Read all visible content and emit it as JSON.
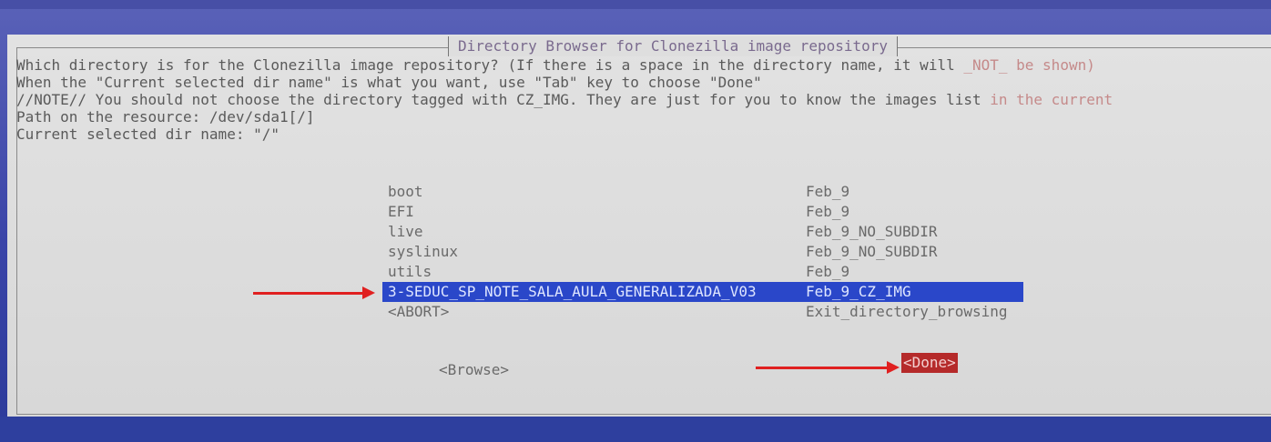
{
  "dialog": {
    "title": "Directory Browser for Clonezilla image repository",
    "lines": [
      "Which directory is for the Clonezilla image repository? (If there is a space in the directory name, it will",
      "When the \"Current selected dir name\" is what you want, use \"Tab\" key to choose \"Done\"",
      "//NOTE// You should not choose the directory tagged with CZ_IMG. They are just for you to know the images list",
      "Path on the resource: /dev/sda1[/]",
      "Current selected dir name: \"/\""
    ],
    "lines_faint": [
      " _NOT_ be shown)",
      "",
      " in the current",
      "",
      ""
    ]
  },
  "list": [
    {
      "name": "boot",
      "tag": "Feb_9"
    },
    {
      "name": "EFI",
      "tag": "Feb_9"
    },
    {
      "name": "live",
      "tag": "Feb_9_NO_SUBDIR"
    },
    {
      "name": "syslinux",
      "tag": "Feb_9_NO_SUBDIR"
    },
    {
      "name": "utils",
      "tag": "Feb_9"
    },
    {
      "name": "3-SEDUC_SP_NOTE_SALA_AULA_GENERALIZADA_V03",
      "tag": "Feb_9_CZ_IMG",
      "selected": true
    },
    {
      "name": "<ABORT>",
      "tag": "Exit_directory_browsing"
    }
  ],
  "buttons": {
    "browse": "<Browse>",
    "done": "<Done>"
  },
  "colors": {
    "selection": "#2a47c9",
    "done_highlight": "#b52a2a",
    "annotation_arrow": "#e02020"
  }
}
